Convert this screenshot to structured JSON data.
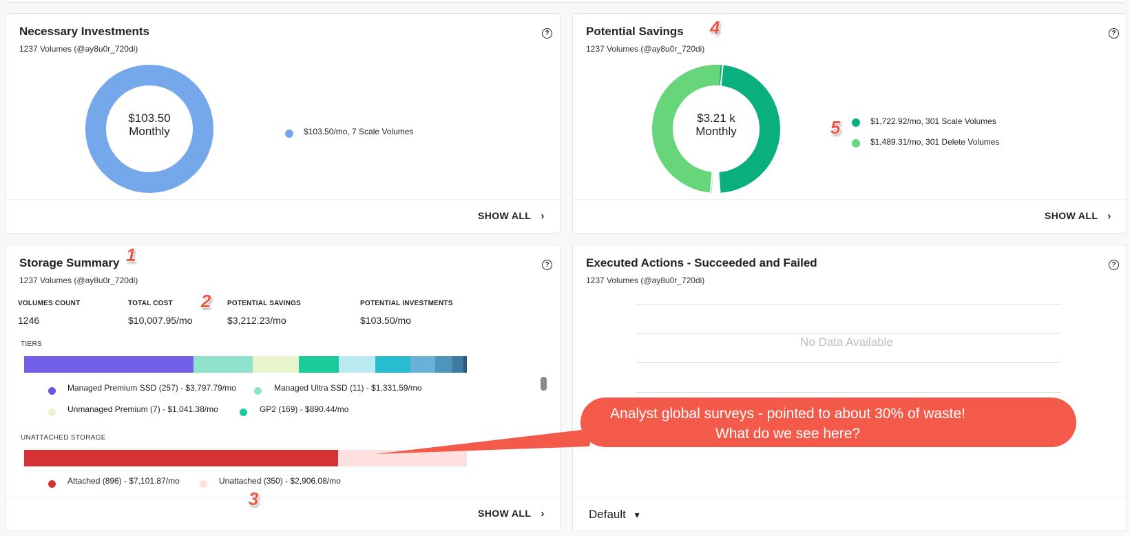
{
  "panels": {
    "necessary_investments": {
      "title": "Necessary Investments",
      "subtitle": "1237 Volumes (@ay8u0r_720di)",
      "center_value": "$103.50",
      "center_label": "Monthly",
      "legend": [
        {
          "label": "$103.50/mo, 7 Scale Volumes",
          "color": "#74a8ea",
          "value": 103.5
        }
      ],
      "show_all": "SHOW ALL"
    },
    "potential_savings": {
      "title": "Potential Savings",
      "subtitle": "1237 Volumes (@ay8u0r_720di)",
      "center_value": "$3.21 k",
      "center_label": "Monthly",
      "legend": [
        {
          "label": "$1,722.92/mo, 301 Scale Volumes",
          "color": "#0aaf7e",
          "value": 1722.92
        },
        {
          "label": "$1,489.31/mo, 301 Delete Volumes",
          "color": "#67d67a",
          "value": 1489.31
        }
      ],
      "show_all": "SHOW ALL"
    },
    "storage_summary": {
      "title": "Storage Summary",
      "subtitle": "1237 Volumes (@ay8u0r_720di)",
      "metrics": [
        {
          "label": "VOLUMES COUNT",
          "value": "1246"
        },
        {
          "label": "TOTAL COST",
          "value": "$10,007.95/mo"
        },
        {
          "label": "POTENTIAL SAVINGS",
          "value": "$3,212.23/mo"
        },
        {
          "label": "POTENTIAL INVESTMENTS",
          "value": "$103.50/mo"
        }
      ],
      "tiers_label": "TIERS",
      "tiers_segments": [
        {
          "color": "#7360e8",
          "value": 3797.79
        },
        {
          "color": "#8ee3ca",
          "value": 1331.59
        },
        {
          "color": "#e8f5cc",
          "value": 1041.38
        },
        {
          "color": "#19cc9a",
          "value": 890.44
        },
        {
          "color": "#b9ebf1",
          "value": 825
        },
        {
          "color": "#28bcd0",
          "value": 780
        },
        {
          "color": "#6ab1d8",
          "value": 560
        },
        {
          "color": "#4d95b9",
          "value": 380
        },
        {
          "color": "#3e7aa0",
          "value": 250
        },
        {
          "color": "#2c5a7a",
          "value": 80
        }
      ],
      "tiers_legend": [
        {
          "label": "Managed Premium SSD (257) - $3,797.79/mo",
          "color": "#6a55e4"
        },
        {
          "label": "Managed Ultra SSD (11) - $1,331.59/mo",
          "color": "#8ee3ca"
        },
        {
          "label": "Unmanaged Premium (7) - $1,041.38/mo",
          "color": "#e8f5cc"
        },
        {
          "label": "GP2 (169) - $890.44/mo",
          "color": "#19cc9a"
        }
      ],
      "unattached_label": "UNATTACHED STORAGE",
      "unattached_segments": [
        {
          "color": "#d63234",
          "value": 7101.87
        },
        {
          "color": "#fde0df",
          "value": 2906.08
        }
      ],
      "unattached_legend": [
        {
          "label": "Attached (896) - $7,101.87/mo",
          "color": "#d63234"
        },
        {
          "label": "Unattached (350) - $2,906.08/mo",
          "color": "#fde0df"
        }
      ],
      "show_all": "SHOW ALL"
    },
    "executed_actions": {
      "title": "Executed Actions - Succeeded and Failed",
      "subtitle": "1237 Volumes (@ay8u0r_720di)",
      "no_data": "No Data Available",
      "dropdown": "Default"
    }
  },
  "help_glyph": "?",
  "chevron_glyph": "›",
  "caret_glyph": "▾",
  "annotations": {
    "numbers": [
      "1",
      "2",
      "3",
      "4",
      "5"
    ],
    "bubble_line1": "Analyst global surveys - pointed to about 30% of waste!",
    "bubble_line2": "What do we see here?",
    "bubble_color": "#f45a4a"
  }
}
